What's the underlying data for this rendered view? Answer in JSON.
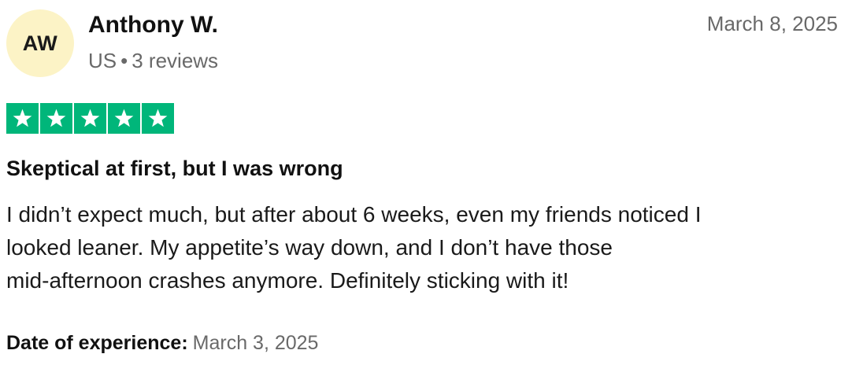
{
  "reviewer": {
    "initials": "AW",
    "name": "Anthony W.",
    "country": "US",
    "separator": "•",
    "review_count": "3 reviews"
  },
  "review": {
    "date": "March 8, 2025",
    "rating": 5,
    "rating_max": 5,
    "star_color": "#00b67a",
    "title": "Skeptical at first, but I was wrong",
    "body_lines": [
      "I didn’t expect much, but after about 6 weeks, even my friends noticed I",
      "looked leaner. My appetite’s way down, and I don’t have those",
      "mid-afternoon crashes anymore. Definitely sticking with it!"
    ],
    "experience_label": "Date of experience:",
    "experience_date": "March 3, 2025"
  },
  "colors": {
    "avatar_bg": "#fcf3c6",
    "muted_text": "#696969"
  },
  "icons": {
    "star": "star-icon"
  }
}
